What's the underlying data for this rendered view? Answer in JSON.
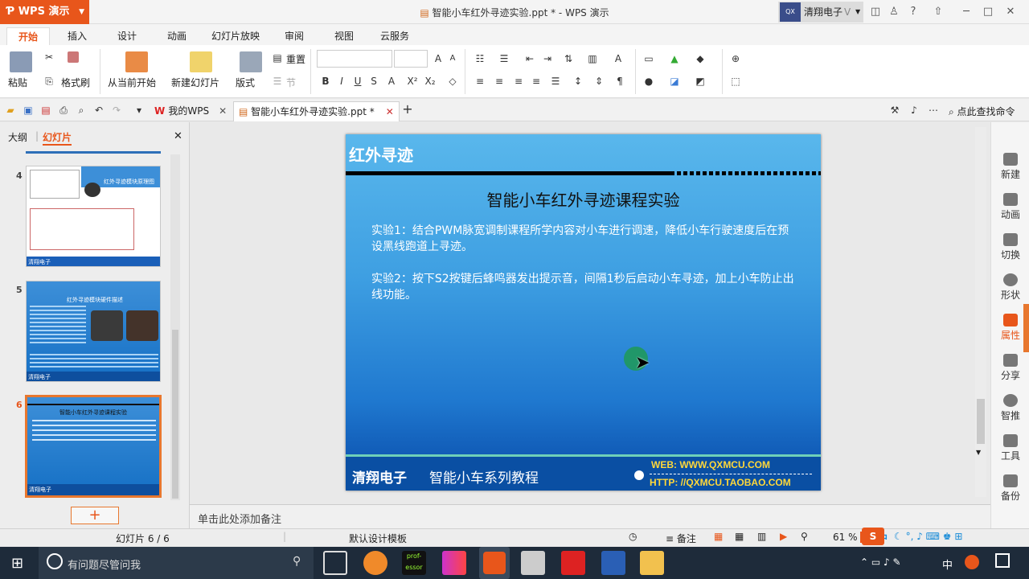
{
  "titlebar": {
    "app_button": "WPS 演示",
    "doc_title": "智能小车红外寻迹实验.ppt * - WPS 演示",
    "user_name": "清翔电子",
    "user_badge": "QX"
  },
  "menu_tabs": [
    "开始",
    "插入",
    "设计",
    "动画",
    "幻灯片放映",
    "审阅",
    "视图",
    "云服务"
  ],
  "ribbon": {
    "paste": "粘贴",
    "format_painter": "格式刷",
    "from_current": "从当前开始",
    "new_slide": "新建幻灯片",
    "layout": "版式",
    "reset": "重置",
    "section": "节"
  },
  "doc_tabs": {
    "my_wps": "我的WPS",
    "file_tab": "智能小车红外寻迹实验.ppt *",
    "search_cmd": "点此查找命令"
  },
  "left_panel": {
    "tab_outline": "大纲",
    "tab_slides": "幻灯片",
    "thumbs": [
      {
        "num": "4",
        "title": "红外寻迹模块原理图",
        "footer": "清翔电子"
      },
      {
        "num": "5",
        "title": "红外寻迹模块硬件描述",
        "footer": "清翔电子"
      },
      {
        "num": "6",
        "title": "智能小车红外寻迹课程实验",
        "footer": "清翔电子"
      }
    ]
  },
  "slide": {
    "header": "红外寻迹",
    "title": "智能小车红外寻迹课程实验",
    "exp1": "实验1：结合PWM脉宽调制课程所学内容对小车进行调速，降低小车行驶速度后在预设黑线跑道上寻迹。",
    "exp2": "实验2：按下S2按键后蜂鸣器发出提示音，间隔1秒后启动小车寻迹，加上小车防止出线功能。",
    "footer_brand": "清翔电子",
    "footer_series": "智能小车系列教程",
    "footer_web": "WEB: WWW.QXMCU.COM",
    "footer_http": "HTTP: //QXMCU.TAOBAO.COM"
  },
  "notes_placeholder": "单击此处添加备注",
  "right_sidebar": [
    "新建",
    "动画",
    "切换",
    "形状",
    "属性",
    "分享",
    "智推",
    "工具",
    "备份"
  ],
  "status": {
    "slide_count": "幻灯片 6 / 6",
    "template": "默认设计模板",
    "notes_btn": "备注",
    "zoom": "61 %"
  },
  "taskbar": {
    "search_placeholder": "有问题尽管问我",
    "ime": "中",
    "colors": {
      "accent": "#e8561b",
      "slide_dark": "#0f58b4",
      "slide_light": "#59b7ec"
    }
  }
}
